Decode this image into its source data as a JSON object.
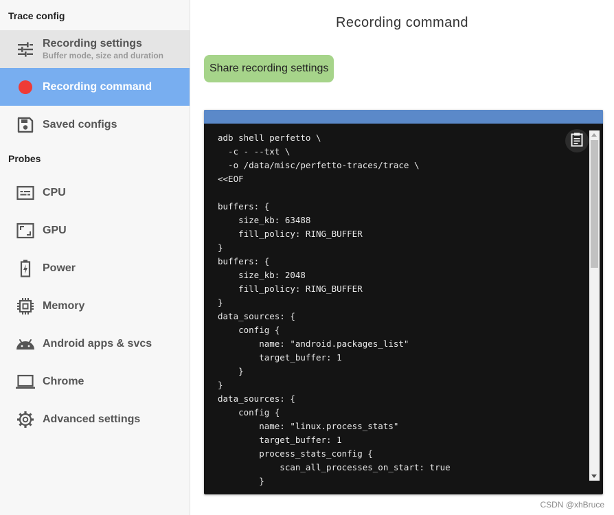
{
  "sidebar": {
    "trace_config_title": "Trace config",
    "probes_title": "Probes",
    "config_items": [
      {
        "label": "Recording settings",
        "sublabel": "Buffer mode, size and duration",
        "icon": "sliders-icon"
      },
      {
        "label": "Recording command",
        "icon": "record-dot-icon"
      },
      {
        "label": "Saved configs",
        "icon": "floppy-disk-icon"
      }
    ],
    "probe_items": [
      {
        "label": "CPU",
        "icon": "cpu-icon"
      },
      {
        "label": "GPU",
        "icon": "gpu-icon"
      },
      {
        "label": "Power",
        "icon": "battery-icon"
      },
      {
        "label": "Memory",
        "icon": "memory-chip-icon"
      },
      {
        "label": "Android apps & svcs",
        "icon": "android-icon"
      },
      {
        "label": "Chrome",
        "icon": "laptop-icon"
      },
      {
        "label": "Advanced settings",
        "icon": "gear-icon"
      }
    ]
  },
  "main": {
    "title": "Recording command",
    "share_button": "Share recording settings",
    "command": "adb shell perfetto \\\n  -c - --txt \\\n  -o /data/misc/perfetto-traces/trace \\\n<<EOF\n\nbuffers: {\n    size_kb: 63488\n    fill_policy: RING_BUFFER\n}\nbuffers: {\n    size_kb: 2048\n    fill_policy: RING_BUFFER\n}\ndata_sources: {\n    config {\n        name: \"android.packages_list\"\n        target_buffer: 1\n    }\n}\ndata_sources: {\n    config {\n        name: \"linux.process_stats\"\n        target_buffer: 1\n        process_stats_config {\n            scan_all_processes_on_start: true\n        }"
  },
  "watermark": "CSDN @xhBruce",
  "colors": {
    "active_nav": "#78aef0",
    "record_dot": "#ef3b36",
    "share_button": "#a6d48a",
    "code_header": "#5b89c9",
    "code_background": "#141414"
  }
}
